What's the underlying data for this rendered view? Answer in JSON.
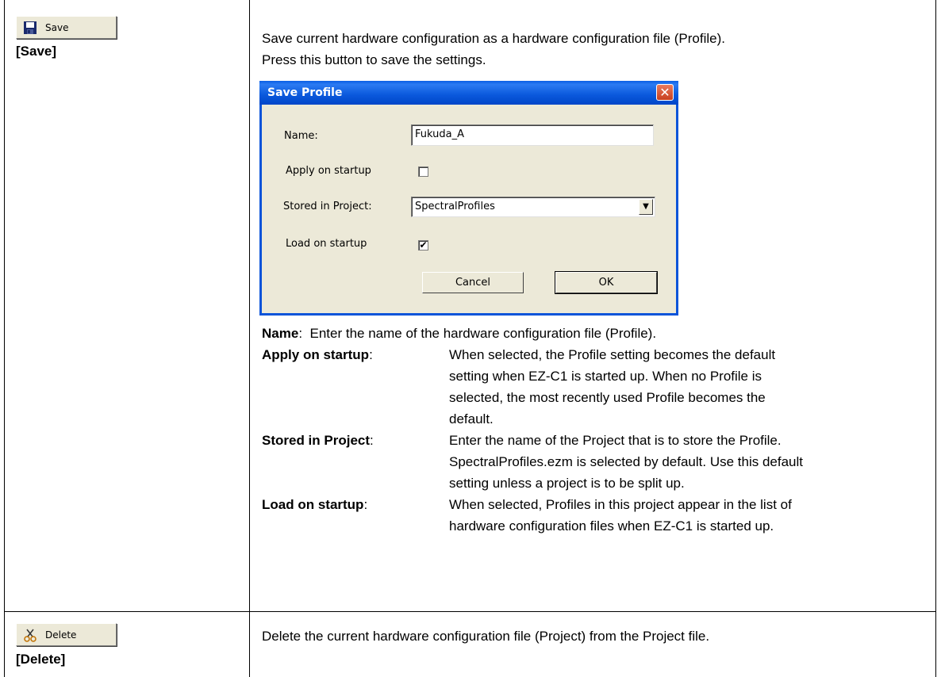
{
  "rows": [
    {
      "button_label": "Save",
      "button_icon": "floppy-disk-icon",
      "caption": "[Save]",
      "description": [
        "Save current hardware configuration as a hardware configuration file (Profile).",
        "Press this button to save the settings."
      ],
      "definitions": [
        {
          "term": "Name",
          "sep": ":",
          "lines": [
            "Enter the name of the hardware configuration file (Profile)."
          ]
        },
        {
          "term": "Apply on startup",
          "sep": ":",
          "lines": [
            "When selected, the Profile setting becomes the default",
            "setting when EZ-C1 is started up. When no Profile is",
            "selected, the most recently used Profile becomes the",
            "default."
          ]
        },
        {
          "term": "Stored in Project",
          "sep": ":",
          "lines": [
            "Enter the name of the Project that is to store the Profile.",
            "SpectralProfiles.ezm is selected by default. Use this default",
            "setting unless a project is to be split up."
          ]
        },
        {
          "term": "Load on startup",
          "sep": ":",
          "lines": [
            "When selected, Profiles in this project appear in the list of",
            "hardware configuration files when EZ-C1 is started up."
          ]
        }
      ]
    },
    {
      "button_label": "Delete",
      "button_icon": "scissors-icon",
      "caption": "[Delete]",
      "description": [
        "Delete the current hardware configuration file (Project) from the Project file."
      ]
    }
  ],
  "dialog": {
    "title": "Save Profile",
    "close_glyph": "✕",
    "name_label": "Name:",
    "name_value": "Fukuda_A",
    "apply_label": "Apply on startup",
    "apply_checked": false,
    "stored_label": "Stored in Project:",
    "stored_value": "SpectralProfiles",
    "load_label": "Load on startup",
    "load_checked": true,
    "check_glyph": "✔",
    "dropdown_glyph": "▼",
    "cancel_label": "Cancel",
    "ok_label": "OK"
  }
}
